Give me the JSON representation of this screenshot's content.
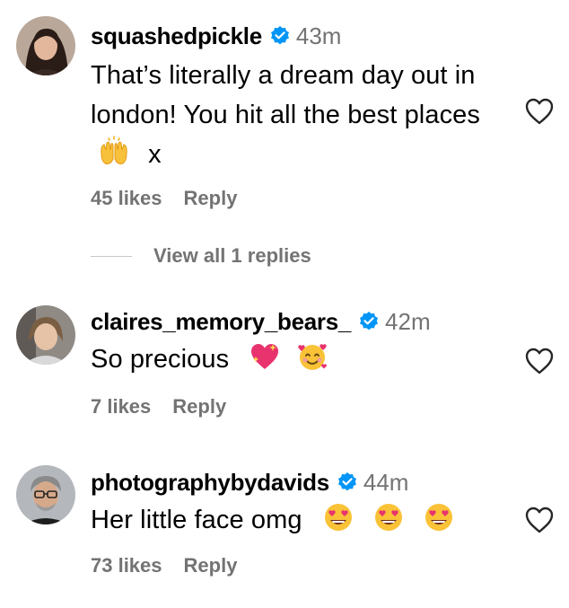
{
  "comments": [
    {
      "username": "squashedpickle",
      "time": "43m",
      "text": "That’s literally a dream day out in london! You hit all the best places",
      "text_suffix": "x",
      "emojis": [
        "raising-hands-emoji"
      ],
      "likes": "45 likes",
      "reply_label": "Reply"
    },
    {
      "username": "claires_memory_bears_",
      "time": "42m",
      "text": "So precious",
      "emojis": [
        "sparkling-heart-emoji",
        "smiling-face-with-hearts-emoji"
      ],
      "likes": "7 likes",
      "reply_label": "Reply"
    },
    {
      "username": "photographybydavids",
      "time": "44m",
      "text": "Her little face omg",
      "emojis": [
        "heart-eyes-emoji",
        "heart-eyes-emoji",
        "heart-eyes-emoji"
      ],
      "likes": "73 likes",
      "reply_label": "Reply"
    }
  ],
  "view_replies": "View all 1 replies",
  "icons": {
    "verified": "verified-badge-icon",
    "like": "heart-outline-icon"
  },
  "colors": {
    "verified_blue": "#0095f6",
    "muted_text": "#737373"
  }
}
